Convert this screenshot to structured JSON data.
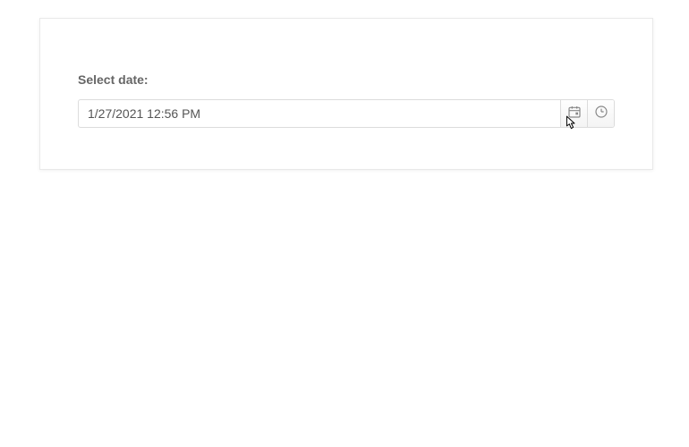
{
  "form": {
    "label": "Select date:",
    "value": "1/27/2021 12:56 PM"
  },
  "icons": {
    "calendar": "calendar-icon",
    "clock": "clock-icon"
  }
}
